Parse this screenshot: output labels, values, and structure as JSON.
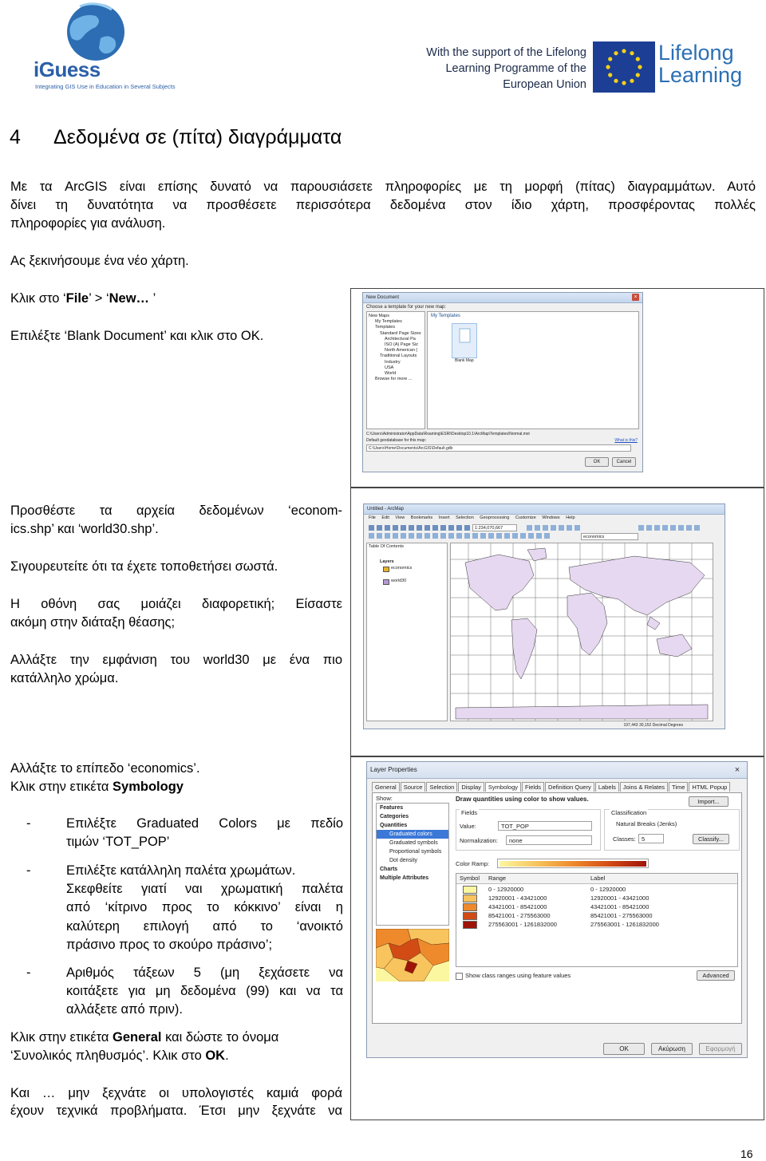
{
  "header": {
    "iguess_logo": "iGuess",
    "iguess_tagline": "Integrating GIS Use in Education in Several Subjects",
    "eu_support_line1": "With the support of the Lifelong",
    "eu_support_line2": "Learning Programme of the",
    "eu_support_line3": "European Union",
    "lifelong_logo_line1": "Lifelong",
    "lifelong_logo_line2": "Learning"
  },
  "section": {
    "number": "4",
    "title": "Δεδομένα σε (πίτα) διαγράμματα"
  },
  "intro": {
    "line1": "Με τα ArcGIS είναι επίσης δυνατό να παρουσιάσετε πληροφορίες με τη μορφή  (πίτας) διαγραμμάτων. Αυτό",
    "line2": "δίνει τη δυνατότητα να προσθέσετε περισσότερα δεδομένα στον ίδιο χάρτη, προσφέροντας πολλές",
    "line3": "πληροφορίες για ανάλυση.",
    "start_map": "Ας ξεκινήσουμε ένα νέο χάρτη."
  },
  "step1": {
    "click_prefix": "Κλικ στο ‘",
    "file": "File",
    "sep": "’ > ‘",
    "new": "New…",
    "click_suffix": " ’",
    "select": "Επιλέξτε ‘Blank Document’ και κλικ στο OK."
  },
  "step2": {
    "line1": "Προσθέστε  τα  αρχεία  δεδομένων  ‘econom-",
    "line2": "ics.shp’ και ‘world30.shp’.",
    "check": "Σιγουρευτείτε ότι τα έχετε τοποθετήσει σωστά.",
    "diff1": "Η  οθόνη  σας  μοιάζει  διαφορετική;  Είσαστε",
    "diff2": "ακόμη στην διάταξη θέασης;",
    "color1": "Αλλάξτε  την  εμφάνιση  του  world30  με  ένα  πιο",
    "color2": "κατάλληλο χρώμα."
  },
  "step3": {
    "change_layer": "Αλλάξτε το επίπεδο ‘economics’.",
    "click_prefix": "Κλικ  στην ετικέτα ",
    "symbology": "Symbology",
    "bullets": [
      [
        "Επιλέξτε  Graduated  Colors  με  πεδίο",
        "τιμών ‘TOT_POP’"
      ],
      [
        "Επιλέξτε κατάλληλη παλέτα χρωμάτων.",
        "Σκεφθείτε  γιατί  ναι  χρωματική  παλέτα",
        "από  ‘κίτρινο  προς  το  κόκκινο’  είναι  η",
        "καλύτερη   επιλογή   από   το   ‘ανοικτό",
        "πράσινο προς το σκούρο πράσινο’;"
      ],
      [
        "Αριθμός  τάξεων  5  (μη  ξεχάσετε  να",
        "κοιτάξετε για μη δεδομένα (99) και να τα",
        "αλλάξετε από πριν)."
      ]
    ],
    "general_prefix": "Κλικ στην ετικέτα  ",
    "general": "General",
    "general_mid": " και δώστε το όνομα",
    "general_line2_prefix": "‘Συνολικός πληθυσμός’. Κλικ στο ",
    "ok": "OK",
    "general_line2_suffix": ".",
    "closing1": "Και  …  μην  ξεχνάτε  οι  υπολογιστές  καμιά  φορά",
    "closing2": "έχουν τεχνικά προβλήματα. Έτσι μην ξεχνάτε να"
  },
  "new_document_dialog": {
    "title": "New Document",
    "prompt": "Choose a template for your new map:",
    "tree": [
      "New Maps",
      "My Templates",
      "Templates",
      "Standard Page Sizes",
      "Architectural Pa",
      "ISO (A) Page Siz",
      "North American (",
      "Traditional Layouts",
      "Industry",
      "USA",
      "World",
      "Browse for more ..."
    ],
    "pane_title": "My Templates",
    "blank_map": "Blank Map",
    "path": "C:\\Users\\Administrator\\AppData\\Roaming\\ESRI\\Desktop10.1\\ArcMap\\Templates\\Normal.mxt",
    "what_is": "What is this?",
    "gdb_label": "Default geodatabase for this map:",
    "gdb_path": "C:\\Users\\Home\\Documents\\ArcGIS\\Default.gdb",
    "ok": "OK",
    "cancel": "Cancel"
  },
  "arcmap_window": {
    "title": "Untitled - ArcMap",
    "menu": [
      "File",
      "Edit",
      "View",
      "Bookmarks",
      "Insert",
      "Selection",
      "Geoprocessing",
      "Customize",
      "Windows",
      "Help"
    ],
    "scale": "1:234,070,667",
    "layer_combo": "economics",
    "toc_title": "Table Of Contents",
    "layers": [
      "Layers",
      "economics",
      "world30"
    ],
    "coords": "197,443  30,152 Decimal Degrees"
  },
  "layer_properties_dialog": {
    "title": "Layer Properties",
    "tabs": [
      "General",
      "Source",
      "Selection",
      "Display",
      "Symbology",
      "Fields",
      "Definition Query",
      "Labels",
      "Joins & Relates",
      "Time",
      "HTML Popup"
    ],
    "show_label": "Show:",
    "show_tree": [
      "Features",
      "Categories",
      "Quantities",
      "Graduated colors",
      "Graduated symbols",
      "Proportional symbols",
      "Dot density",
      "Charts",
      "Multiple Attributes"
    ],
    "heading": "Draw quantities using color to show values.",
    "import": "Import...",
    "fields_label": "Fields",
    "value_label": "Value:",
    "value": "TOT_POP",
    "normalization_label": "Normalization:",
    "normalization": "none",
    "classification_label": "Classification",
    "classification": "Natural Breaks (Jenks)",
    "classes_label": "Classes:",
    "classes": "5",
    "classify": "Classify...",
    "color_ramp_label": "Color Ramp:",
    "col_symbol": "Symbol",
    "col_range": "Range",
    "col_label": "Label",
    "rows": [
      {
        "range": "0 - 12920000",
        "label": "0 - 12920000",
        "color": "#fbf7a0"
      },
      {
        "range": "12920001 - 43421000",
        "label": "12920001 - 43421000",
        "color": "#f7c45e"
      },
      {
        "range": "43421001 - 85421000",
        "label": "43421001 - 85421000",
        "color": "#ee8a2c"
      },
      {
        "range": "85421001 - 275563000",
        "label": "85421001 - 275563000",
        "color": "#d24b15"
      },
      {
        "range": "275563001 - 1261832000",
        "label": "275563001 - 1261832000",
        "color": "#9e1408"
      }
    ],
    "show_ranges": "Show class ranges using feature values",
    "advanced": "Advanced",
    "ok": "OK",
    "cancel": "Ακύρωση",
    "apply": "Εφαρμογή"
  },
  "page_number": "16"
}
